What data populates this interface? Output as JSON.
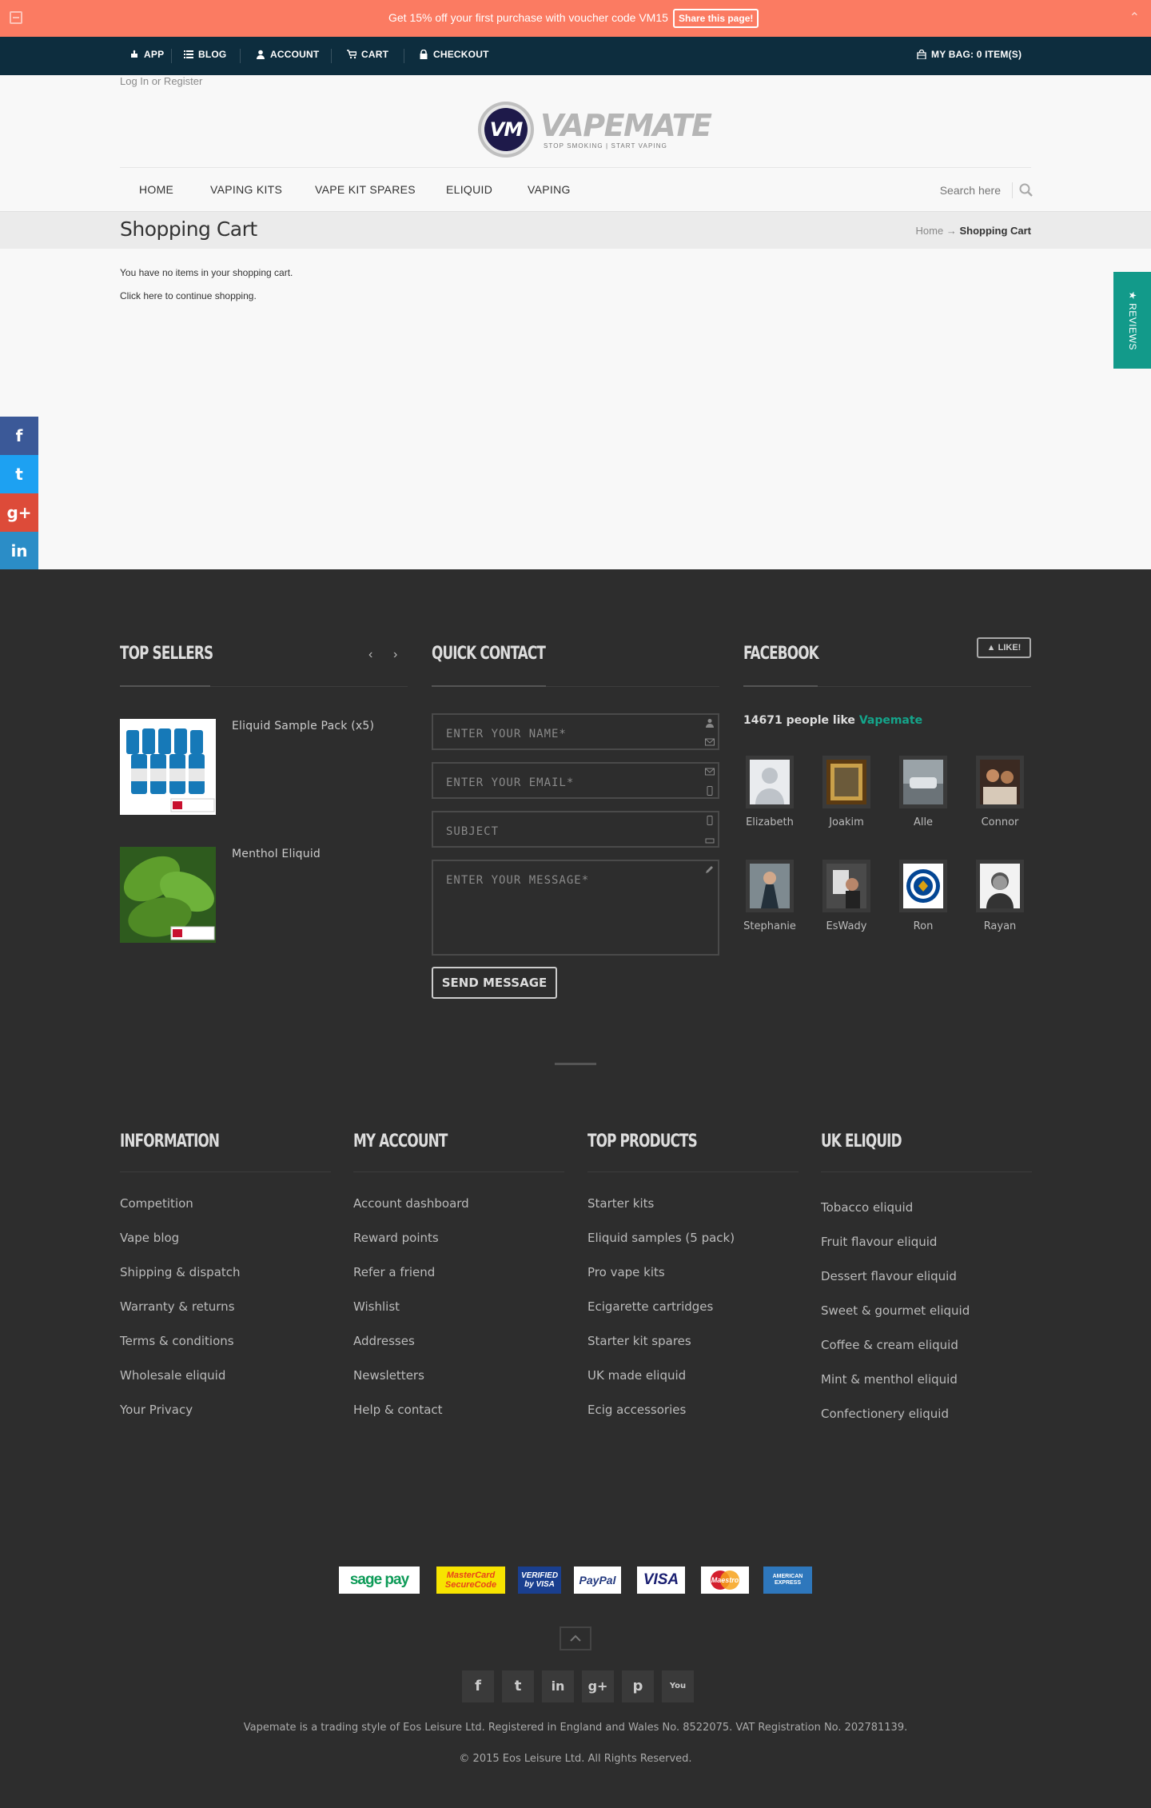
{
  "promo": {
    "text": "Get 15% off your first purchase with voucher code VM15",
    "share_label": "Share this page!",
    "close_glyph": "⌃"
  },
  "topnav": {
    "items": [
      {
        "label": "APP",
        "icon": "puzzle-icon"
      },
      {
        "label": "BLOG",
        "icon": "list-icon"
      },
      {
        "label": "ACCOUNT",
        "icon": "user-icon"
      },
      {
        "label": "CART",
        "icon": "cart-icon"
      },
      {
        "label": "CHECKOUT",
        "icon": "lock-icon"
      }
    ],
    "bag_label": "MY BAG: 0 ITEM(S)",
    "bag_icon": "bag-icon"
  },
  "header": {
    "login_text": "Log In or Register",
    "logo_monogram": "VM",
    "logo_name": "VAPEMATE",
    "logo_tagline": "STOP SMOKING | START VAPING",
    "nav": [
      "HOME",
      "VAPING KITS",
      "VAPE KIT SPARES",
      "ELIQUID",
      "VAPING"
    ],
    "search_placeholder": "Search here"
  },
  "page": {
    "title": "Shopping Cart",
    "breadcrumb_home": "Home",
    "breadcrumb_sep": "→",
    "breadcrumb_current": "Shopping Cart",
    "empty_message": "You have no items in your shopping cart.",
    "continue_message": "Click here to continue shopping.",
    "reviews_tab": "★ REVIEWS"
  },
  "social_sidebar": [
    {
      "icon": "facebook-icon",
      "glyph": "f",
      "color": "#3b5998"
    },
    {
      "icon": "twitter-icon",
      "glyph": "t",
      "color": "#1da1f2"
    },
    {
      "icon": "googleplus-icon",
      "glyph": "g+",
      "color": "#dd4b39"
    },
    {
      "icon": "linkedin-icon",
      "glyph": "in",
      "color": "#2b8dc7"
    },
    {
      "icon": "plus-icon",
      "glyph": "+",
      "color": "#f26b52"
    }
  ],
  "top_sellers": {
    "title": "TOP SELLERS",
    "prev": "‹",
    "next": "›",
    "products": [
      "Eliquid Sample Pack (x5)",
      "Menthol Eliquid"
    ]
  },
  "quick_contact": {
    "title": "QUICK CONTACT",
    "name_placeholder": "ENTER YOUR NAME*",
    "email_placeholder": "ENTER YOUR EMAIL*",
    "subject_placeholder": "SUBJECT",
    "message_placeholder": "ENTER YOUR MESSAGE*",
    "send_label": "SEND MESSAGE"
  },
  "facebook": {
    "title": "FACEBOOK",
    "like_label": "LIKE!",
    "count_text": "14671 people like",
    "page_name": "Vapemate",
    "people": [
      "Elizabeth",
      "Joakim",
      "Alle",
      "Connor",
      "Stephanie",
      "EsWady",
      "Ron",
      "Rayan"
    ]
  },
  "footer_links": {
    "information": {
      "title": "INFORMATION",
      "links": [
        "Competition",
        "Vape blog",
        "Shipping & dispatch",
        "Warranty & returns",
        "Terms & conditions",
        "Wholesale eliquid",
        "Your Privacy"
      ]
    },
    "my_account": {
      "title": "MY ACCOUNT",
      "links": [
        "Account dashboard",
        "Reward points",
        "Refer a friend",
        "Wishlist",
        "Addresses",
        "Newsletters",
        "Help & contact"
      ]
    },
    "top_products": {
      "title": "TOP PRODUCTS",
      "links": [
        "Starter kits",
        "Eliquid samples (5 pack)",
        "Pro vape kits",
        "Ecigarette cartridges",
        "Starter kit spares",
        "UK made eliquid",
        "Ecig accessories"
      ]
    },
    "uk_eliquid": {
      "title": "UK ELIQUID",
      "links": [
        "Tobacco eliquid",
        "Fruit flavour eliquid",
        "Dessert flavour eliquid",
        "Sweet & gourmet eliquid",
        "Coffee & cream eliquid",
        "Mint & menthol eliquid",
        "Confectionery eliquid"
      ]
    }
  },
  "payments": [
    {
      "name": "sagepay",
      "label": "sage pay",
      "color": "#0e9b58"
    },
    {
      "name": "mastercard-securecode",
      "label": "MasterCard SecureCode",
      "color": "#e8451b"
    },
    {
      "name": "verified-by-visa",
      "label": "VERIFIED by VISA",
      "color": "#1a3f8f"
    },
    {
      "name": "paypal",
      "label": "PayPal",
      "color": "#253b80"
    },
    {
      "name": "visa",
      "label": "VISA",
      "color": "#1a1f71"
    },
    {
      "name": "maestro",
      "label": "Maestro",
      "color": "#d41f2e"
    },
    {
      "name": "amex",
      "label": "AMERICAN EXPRESS",
      "color": "#2e77bc"
    }
  ],
  "footer_social": [
    {
      "icon": "facebook-icon",
      "glyph": "f"
    },
    {
      "icon": "twitter-icon",
      "glyph": "t"
    },
    {
      "icon": "linkedin-icon",
      "glyph": "in"
    },
    {
      "icon": "googleplus-icon",
      "glyph": "g+"
    },
    {
      "icon": "pinterest-icon",
      "glyph": "p"
    },
    {
      "icon": "youtube-icon",
      "glyph": "You"
    }
  ],
  "legal": {
    "company": "Vapemate is a trading style of Eos Leisure Ltd. Registered in England and Wales No. 8522075. VAT Registration No. 202781139.",
    "copyright": "© 2015 Eos Leisure Ltd. All Rights Reserved."
  }
}
